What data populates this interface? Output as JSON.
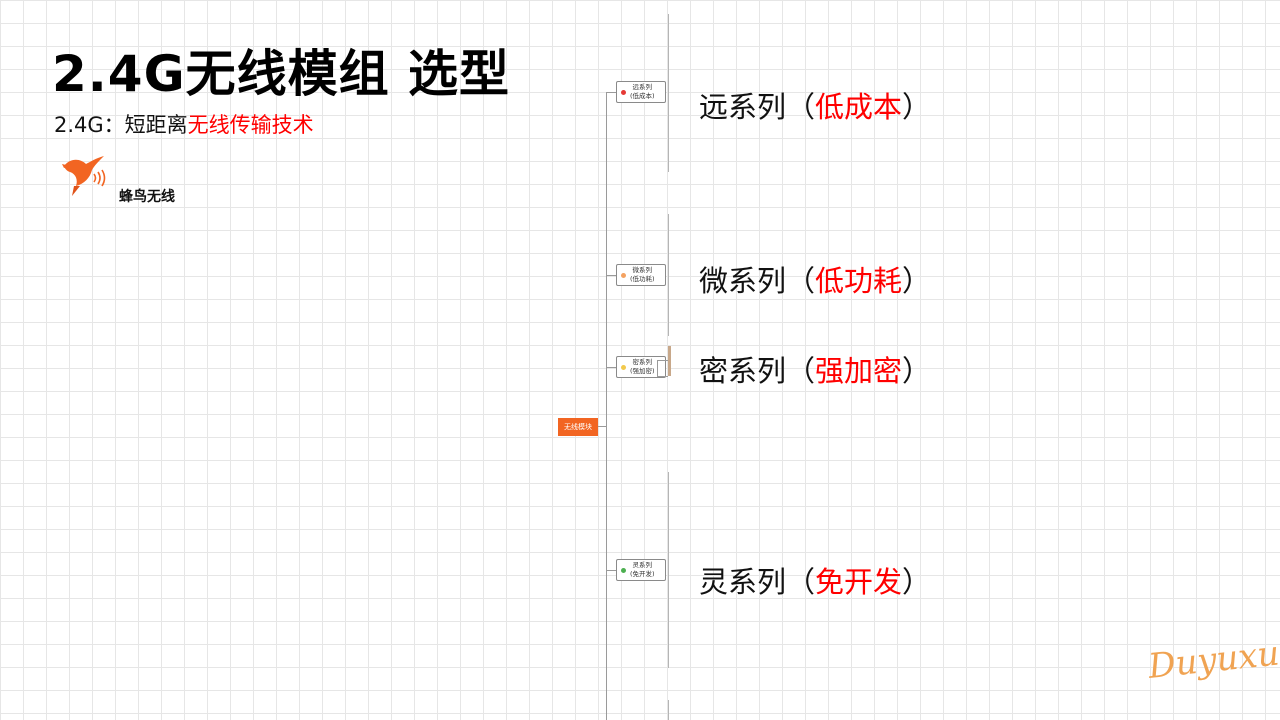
{
  "header": {
    "title": "2.4G无线模组 选型",
    "subtitle_prefix": "2.4G：短距离",
    "subtitle_highlight": "无线传输技术"
  },
  "brand": {
    "logo_icon": "hummingbird-icon",
    "name": "蜂鸟无线",
    "color": "#f26522"
  },
  "mindmap": {
    "root": "无线模块",
    "nodes": [
      {
        "line1": "远系列",
        "line2": "(低成本)",
        "dot_color": "#e53935"
      },
      {
        "line1": "微系列",
        "line2": "(低功耗)",
        "dot_color": "#f4a261"
      },
      {
        "line1": "密系列",
        "line2": "(强加密)",
        "dot_color": "#f2c94c"
      },
      {
        "line1": "灵系列",
        "line2": "(免开发)",
        "dot_color": "#4caf50"
      }
    ]
  },
  "labels": [
    {
      "series": "远系列（",
      "feature": "低成本",
      "close": "）"
    },
    {
      "series": "微系列（",
      "feature": "低功耗",
      "close": "）"
    },
    {
      "series": "密系列（",
      "feature": "强加密",
      "close": "）"
    },
    {
      "series": "灵系列（",
      "feature": "免开发",
      "close": "）"
    }
  ],
  "signature": "Duyuxuan",
  "colors": {
    "accent_red": "#ff0000",
    "brand_orange": "#f26522",
    "signature": "#f0a352"
  }
}
